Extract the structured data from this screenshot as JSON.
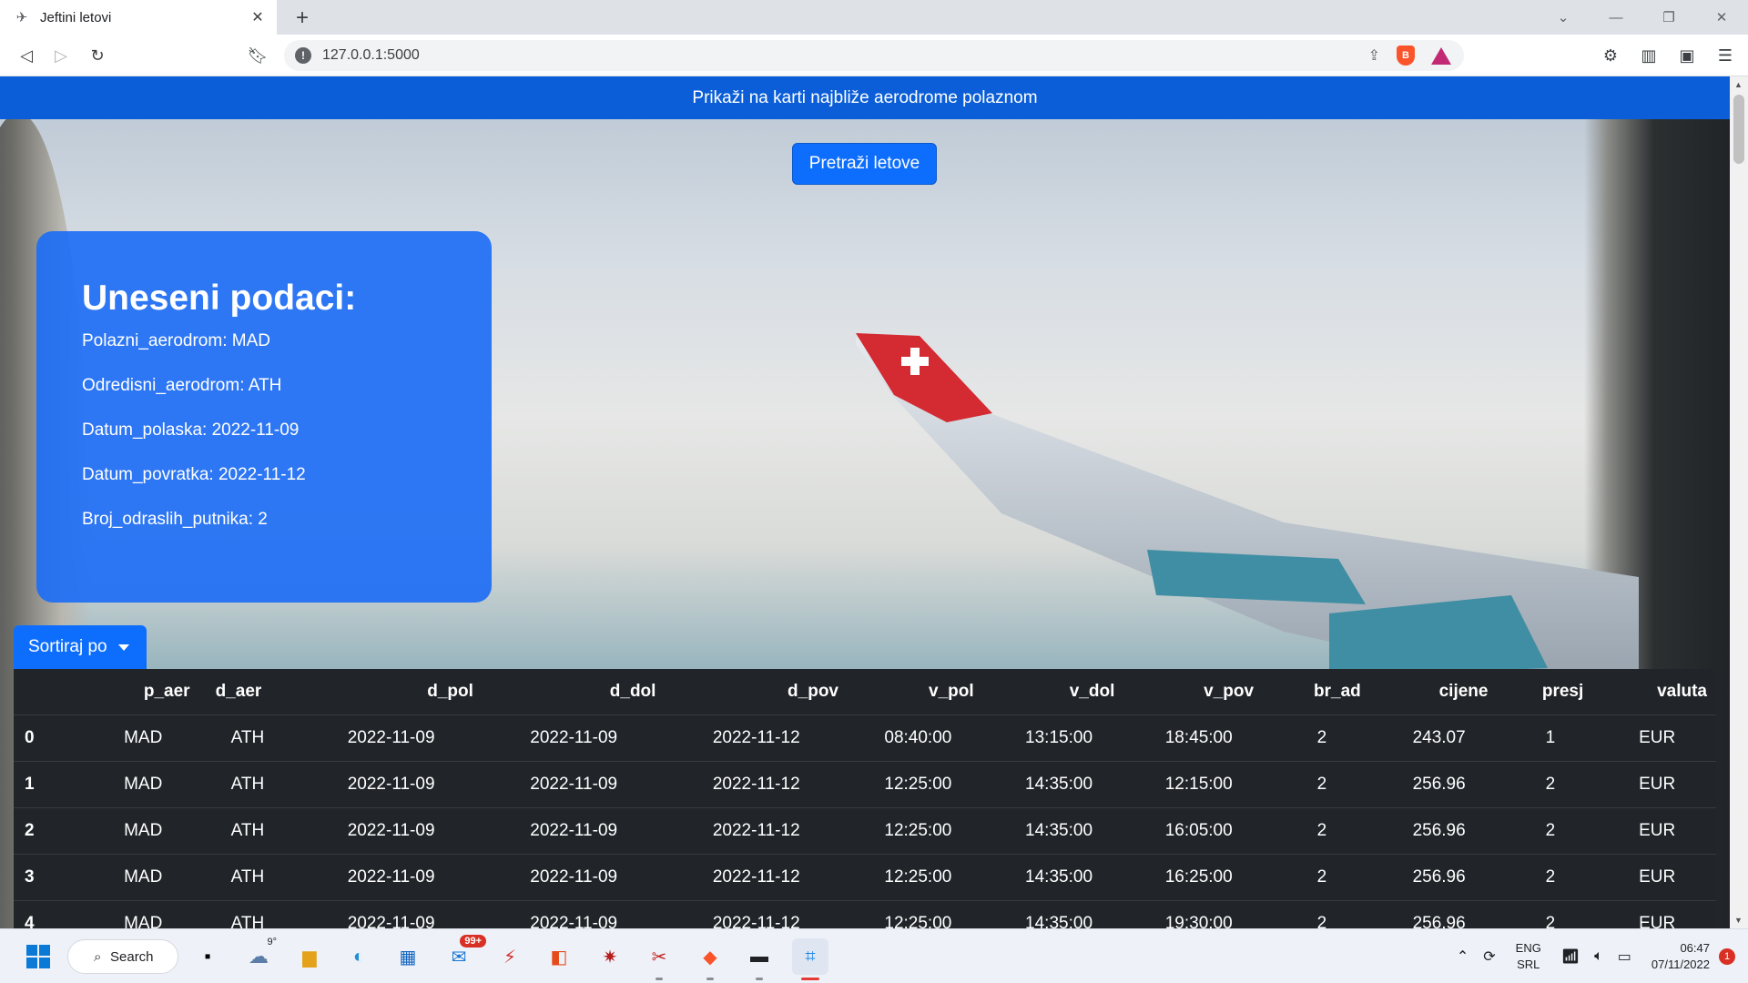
{
  "browser": {
    "tab_title": "Jeftini letovi",
    "url": "127.0.0.1:5000"
  },
  "page": {
    "banner": "Prikaži na karti najbliže aerodrome polaznom",
    "search_button": "Pretraži letove",
    "card": {
      "heading": "Uneseni podaci:",
      "lines": [
        "Polazni_aerodrom: MAD",
        "Odredisni_aerodrom: ATH",
        "Datum_polaska: 2022-11-09",
        "Datum_povratka: 2022-11-12",
        "Broj_odraslih_putnika: 2"
      ]
    },
    "sort_button": "Sortiraj po",
    "table": {
      "headers": [
        "",
        "p_aer",
        "d_aer",
        "d_pol",
        "d_dol",
        "d_pov",
        "v_pol",
        "v_dol",
        "v_pov",
        "br_ad",
        "cijene",
        "presj",
        "valuta"
      ],
      "rows": [
        [
          "0",
          "MAD",
          "ATH",
          "2022-11-09",
          "2022-11-09",
          "2022-11-12",
          "08:40:00",
          "13:15:00",
          "18:45:00",
          "2",
          "243.07",
          "1",
          "EUR"
        ],
        [
          "1",
          "MAD",
          "ATH",
          "2022-11-09",
          "2022-11-09",
          "2022-11-12",
          "12:25:00",
          "14:35:00",
          "12:15:00",
          "2",
          "256.96",
          "2",
          "EUR"
        ],
        [
          "2",
          "MAD",
          "ATH",
          "2022-11-09",
          "2022-11-09",
          "2022-11-12",
          "12:25:00",
          "14:35:00",
          "16:05:00",
          "2",
          "256.96",
          "2",
          "EUR"
        ],
        [
          "3",
          "MAD",
          "ATH",
          "2022-11-09",
          "2022-11-09",
          "2022-11-12",
          "12:25:00",
          "14:35:00",
          "16:25:00",
          "2",
          "256.96",
          "2",
          "EUR"
        ],
        [
          "4",
          "MAD",
          "ATH",
          "2022-11-09",
          "2022-11-09",
          "2022-11-12",
          "12:25:00",
          "14:35:00",
          "19:30:00",
          "2",
          "256.96",
          "2",
          "EUR"
        ]
      ]
    }
  },
  "taskbar": {
    "search_label": "Search",
    "weather_temp": "9°",
    "mail_badge": "99+",
    "lang_top": "ENG",
    "lang_bottom": "SRL",
    "time": "06:47",
    "date": "07/11/2022",
    "notification_count": "1"
  },
  "colors": {
    "primary": "#0d6efd",
    "banner": "#0b5ed7",
    "table_bg": "#212529"
  }
}
